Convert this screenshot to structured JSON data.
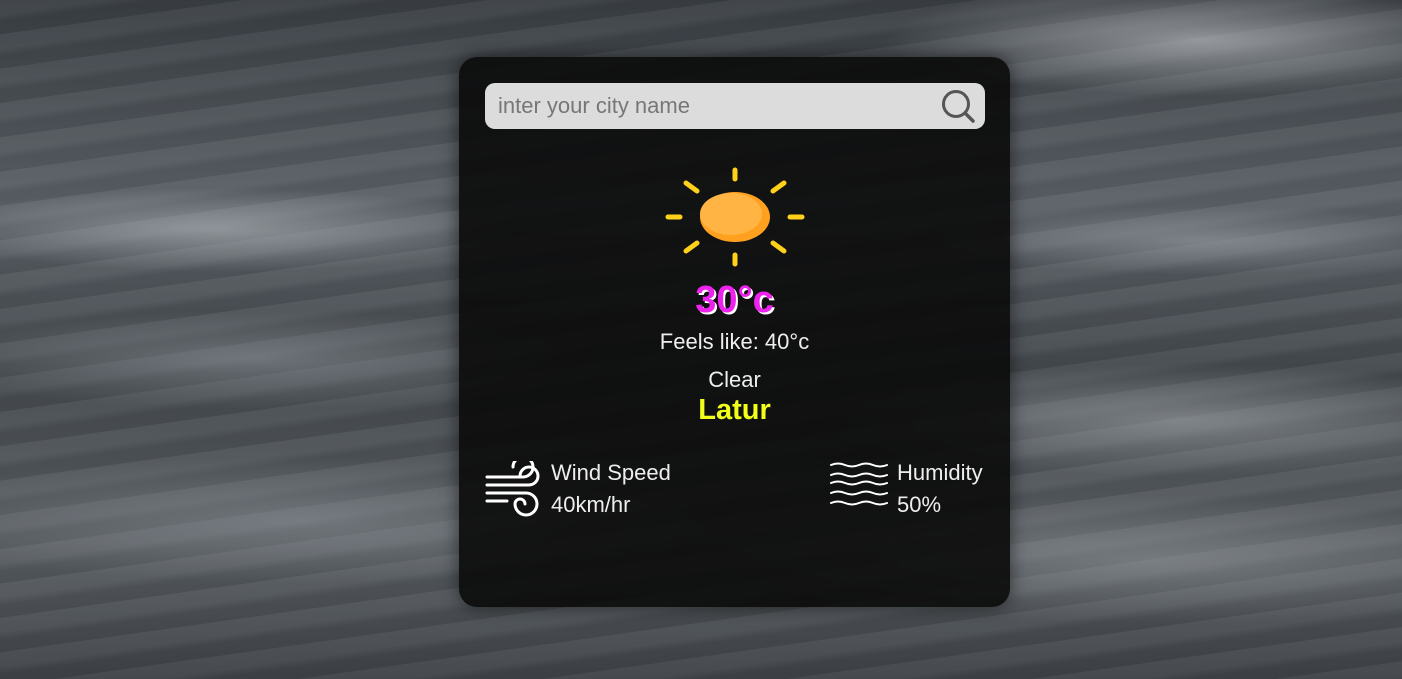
{
  "search": {
    "placeholder": "inter your city name",
    "value": "",
    "icon": "search-icon"
  },
  "weather": {
    "icon": "sun-icon",
    "temperature": "30°c",
    "feels_like": "Feels like: 40°c",
    "condition": "Clear",
    "city": "Latur"
  },
  "details": {
    "wind": {
      "icon": "wind-icon",
      "label": "Wind Speed",
      "value": "40km/hr"
    },
    "humidity": {
      "icon": "humidity-waves-icon",
      "label": "Humidity",
      "value": "50%"
    }
  },
  "colors": {
    "card_background": "#0a0a0a",
    "search_background": "#dcdcdc",
    "temperature": "#ee22ee",
    "city": "#f2ff1a",
    "sun_rays": "#ffd11a",
    "sun_body": "#ffaa33",
    "text": "#eeeeee"
  }
}
